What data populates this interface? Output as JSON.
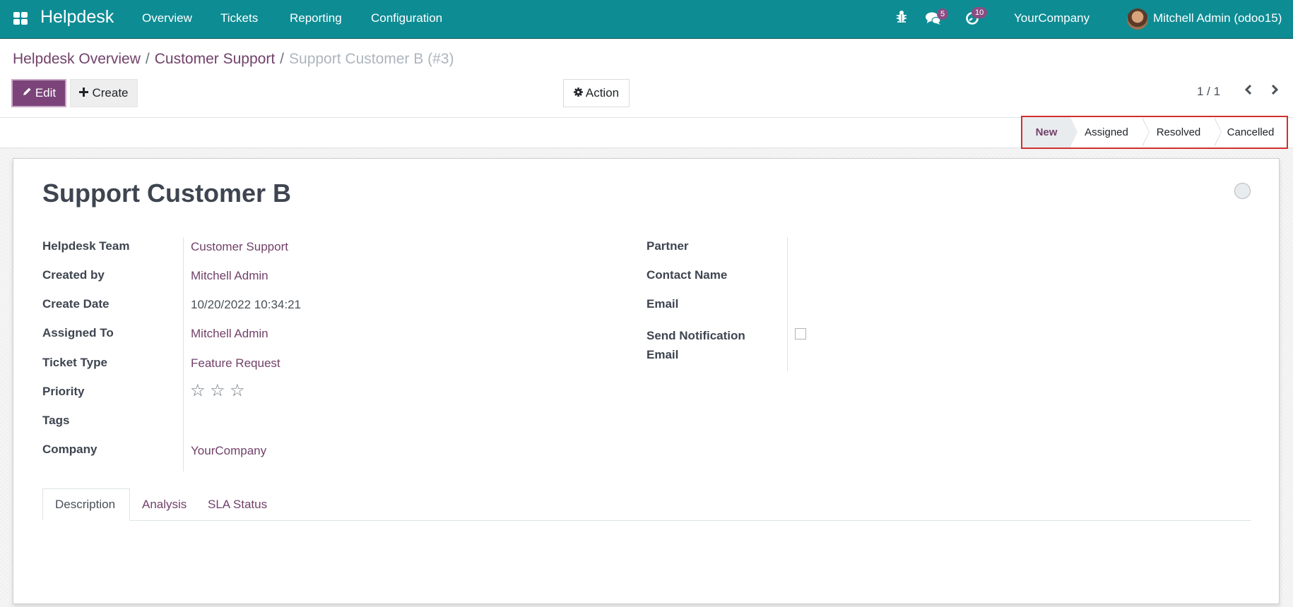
{
  "navbar": {
    "app_name": "Helpdesk",
    "menu": [
      "Overview",
      "Tickets",
      "Reporting",
      "Configuration"
    ],
    "icons": {
      "apps": "apps-grid-icon",
      "debug": "bug-icon",
      "messages": "chat-icon",
      "activities": "clock-icon"
    },
    "messages_count": "5",
    "activities_count": "10",
    "company": "YourCompany",
    "user": "Mitchell Admin (odoo15)",
    "badge_color": "#8a4d83",
    "bar_color": "#0e8c94"
  },
  "breadcrumb": {
    "items": [
      "Helpdesk Overview",
      "Customer Support"
    ],
    "current": "Support Customer B (#3)",
    "separator": "/"
  },
  "toolbar": {
    "edit_label": "Edit",
    "create_label": "Create",
    "action_label": "Action",
    "pager": "1 / 1"
  },
  "stages": {
    "items": [
      "New",
      "Assigned",
      "Resolved",
      "Cancelled"
    ],
    "active": "New"
  },
  "record": {
    "title": "Support Customer B",
    "left_fields": [
      {
        "label": "Helpdesk Team",
        "value": "Customer Support"
      },
      {
        "label": "Created by",
        "value": "Mitchell Admin"
      },
      {
        "label": "Create Date",
        "value": "10/20/2022 10:34:21"
      },
      {
        "label": "Assigned To",
        "value": "Mitchell Admin"
      },
      {
        "label": "Ticket Type",
        "value": "Feature Request"
      },
      {
        "label": "Priority",
        "value": "0 of 3 stars"
      },
      {
        "label": "Tags",
        "value": ""
      },
      {
        "label": "Company",
        "value": "YourCompany"
      }
    ],
    "right_fields": [
      {
        "label": "Partner",
        "value": ""
      },
      {
        "label": "Contact Name",
        "value": ""
      },
      {
        "label": "Email",
        "value": ""
      },
      {
        "label": "Send Notification Email",
        "value": "unchecked"
      }
    ],
    "priority_stars": 0,
    "priority_max": 3,
    "star_glyph": "☆"
  },
  "tabs": [
    "Description",
    "Analysis",
    "SLA Status"
  ],
  "accent_color": "#71416a"
}
